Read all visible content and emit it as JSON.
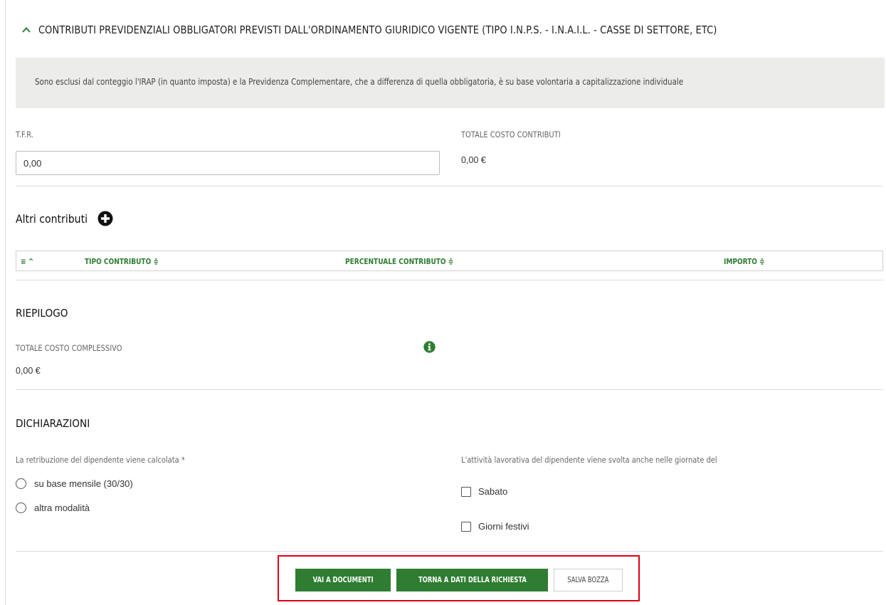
{
  "section": {
    "title": "CONTRIBUTI PREVIDENZIALI OBBLIGATORI PREVISTI DALL'ORDINAMENTO GIURIDICO VIGENTE (TIPO I.N.P.S. - I.N.A.I.L. - CASSE DI SETTORE, ETC)",
    "note": "Sono esclusi dal conteggio l'IRAP (in quanto imposta) e la Previdenza Complementare, che a differenza di quella obbligatoria, è su base volontaria a capitalizzazione individuale"
  },
  "tfr": {
    "label": "T.F.R.",
    "value": "0,00"
  },
  "totale_contributi": {
    "label": "TOTALE COSTO CONTRIBUTI",
    "value": "0,00 €"
  },
  "altri_contributi": {
    "title": "Altri contributi",
    "columns": [
      "TIPO CONTRIBUTO ≑",
      "PERCENTUALE CONTRIBUTO ≑",
      "IMPORTO ≑"
    ],
    "index_header": "≡ ^"
  },
  "riepilogo": {
    "title": "RIEPILOGO",
    "label": "TOTALE COSTO COMPLESSIVO",
    "value": "0,00 €"
  },
  "dichiarazioni": {
    "title": "DICHIARAZIONI",
    "retribuzione_label": "La retribuzione del dipendente viene calcolata *",
    "radio_options": [
      "su base mensile (30/30)",
      "altra modalità"
    ],
    "attivita_label": "L'attività lavorativa del dipendente viene svolta anche nelle giornate del",
    "checkbox_options": [
      "Sabato",
      "Giorni festivi"
    ]
  },
  "actions": {
    "vai_documenti": "VAI A DOCUMENTI",
    "torna_dati": "TORNA A DATI DELLA RICHIESTA",
    "salva_bozza": "SALVA BOZZA"
  },
  "colors": {
    "accent_green": "#2e7d32",
    "highlight_red": "#e0001a"
  }
}
